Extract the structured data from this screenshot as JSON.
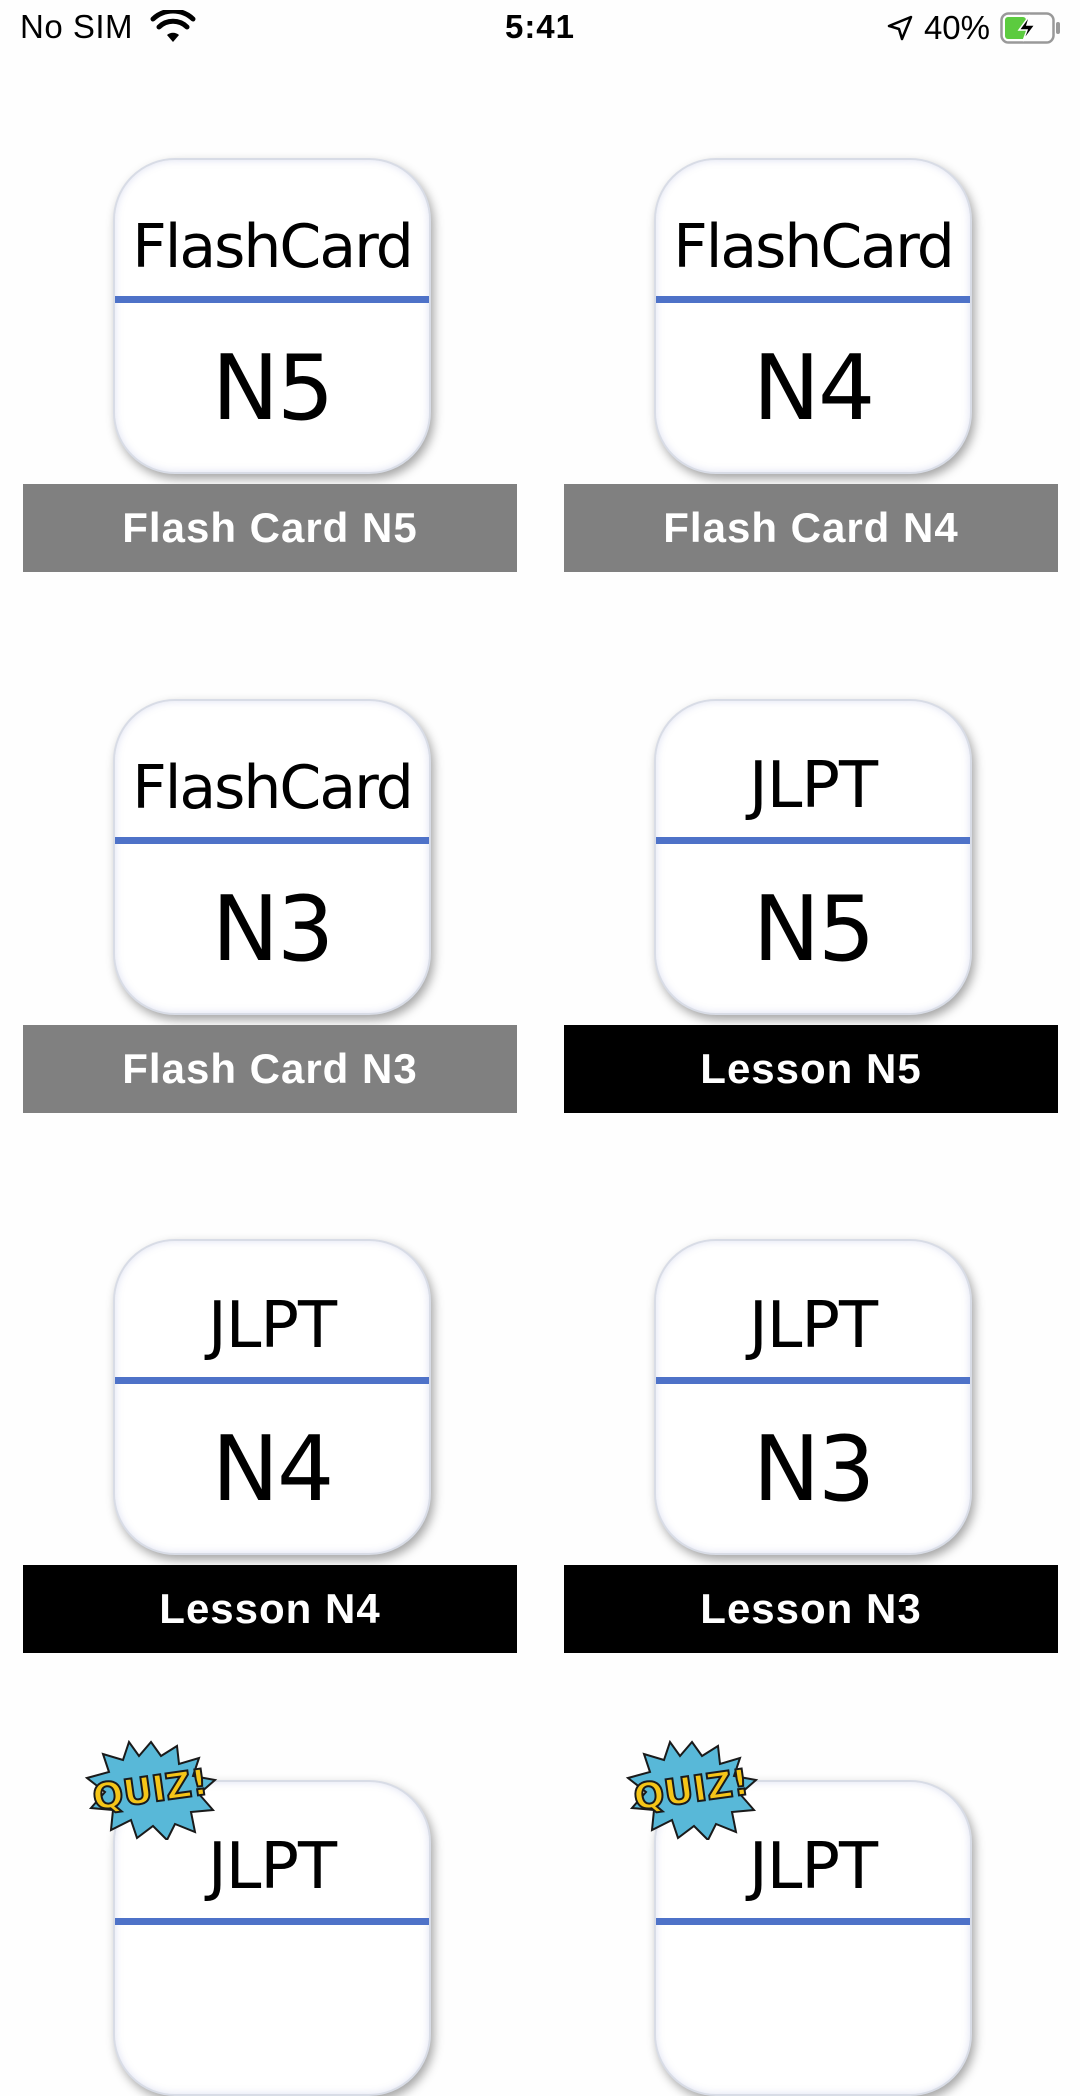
{
  "status_bar": {
    "carrier": "No SIM",
    "time": "5:41",
    "battery_percent": "40%",
    "icons": [
      "wifi-icon",
      "location-arrow-icon",
      "battery-charging-icon"
    ]
  },
  "tiles": [
    {
      "top_text": "FlashCard",
      "bottom_text": "N5",
      "caption": "Flash Card N5",
      "caption_style": "grey"
    },
    {
      "top_text": "FlashCard",
      "bottom_text": "N4",
      "caption": "Flash Card N4",
      "caption_style": "grey"
    },
    {
      "top_text": "FlashCard",
      "bottom_text": "N3",
      "caption": "Flash Card N3",
      "caption_style": "grey"
    },
    {
      "top_text": "JLPT",
      "bottom_text": "N5",
      "caption": "Lesson N5",
      "caption_style": "black"
    },
    {
      "top_text": "JLPT",
      "bottom_text": "N4",
      "caption": "Lesson N4",
      "caption_style": "black"
    },
    {
      "top_text": "JLPT",
      "bottom_text": "N3",
      "caption": "Lesson N3",
      "caption_style": "black"
    },
    {
      "top_text": "JLPT",
      "bottom_text": "",
      "caption": "",
      "caption_style": "none",
      "badge": "QUIZ!"
    },
    {
      "top_text": "JLPT",
      "bottom_text": "",
      "caption": "",
      "caption_style": "none",
      "badge": "QUIZ!"
    }
  ],
  "colors": {
    "caption_grey": "#808080",
    "caption_black": "#000000",
    "divider_blue": "#4e72c8",
    "battery_green": "#5ccb3f",
    "quiz_yellow": "#f5c518",
    "quiz_blue": "#58b8d8"
  }
}
